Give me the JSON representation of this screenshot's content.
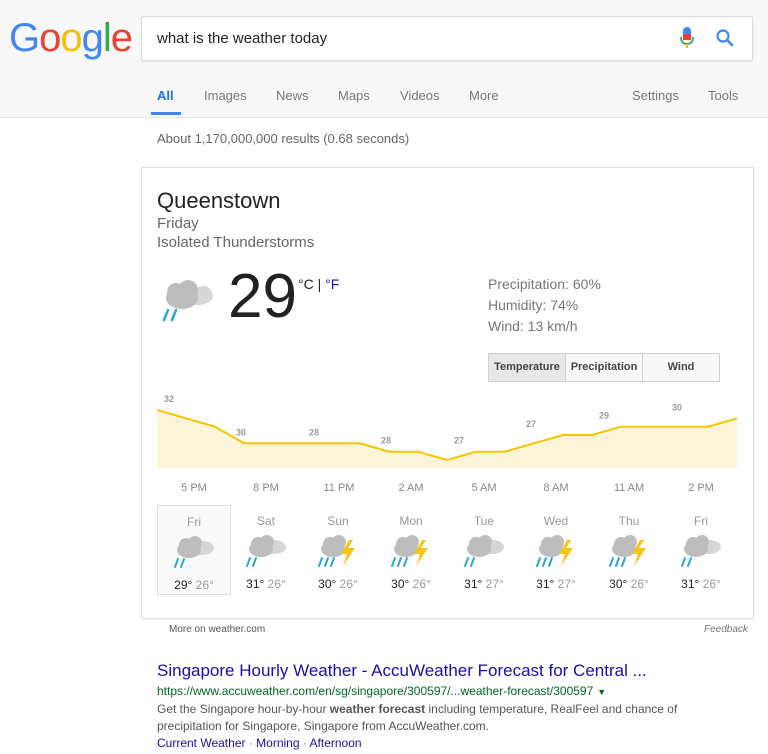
{
  "logo": {
    "letters": [
      "G",
      "o",
      "o",
      "g",
      "l",
      "e"
    ],
    "colors": [
      "#4285f4",
      "#ea4335",
      "#fbbc05",
      "#4285f4",
      "#34a853",
      "#ea4335"
    ]
  },
  "search": {
    "query": "what is the weather today",
    "mic_icon": "mic-icon",
    "search_icon": "search-icon"
  },
  "tabs": {
    "all": "All",
    "images": "Images",
    "news": "News",
    "maps": "Maps",
    "videos": "Videos",
    "more": "More",
    "settings": "Settings",
    "tools": "Tools"
  },
  "stats": "About 1,170,000,000 results (0.68 seconds)",
  "weather": {
    "location": "Queenstown",
    "day": "Friday",
    "condition": "Isolated Thunderstorms",
    "temp": "29",
    "unit_c": "°C",
    "unit_sep": " | ",
    "unit_f": "°F",
    "precipitation": "Precipitation: 60%",
    "humidity": "Humidity: 74%",
    "wind": "Wind: 13 km/h",
    "buttons": {
      "temperature": "Temperature",
      "precipitation": "Precipitation",
      "wind": "Wind"
    },
    "chart_data": {
      "type": "area",
      "temps": [
        32,
        31,
        30,
        28,
        28,
        28,
        28,
        28,
        27,
        27,
        26,
        27,
        27,
        28,
        29,
        29,
        30,
        30,
        30,
        30,
        31
      ],
      "labels": [
        "32",
        "30",
        "28",
        "28",
        "27",
        "27",
        "29",
        "30"
      ],
      "times": [
        "5 PM",
        "8 PM",
        "11 PM",
        "2 AM",
        "5 AM",
        "8 AM",
        "11 AM",
        "2 PM"
      ],
      "fill": "#fdf5d8",
      "stroke": "#f7c500"
    },
    "forecast": [
      {
        "day": "Fri",
        "hi": "29°",
        "lo": "26°",
        "icon": "rain-cloud-icon"
      },
      {
        "day": "Sat",
        "hi": "31°",
        "lo": "26°",
        "icon": "rain-cloud-icon"
      },
      {
        "day": "Sun",
        "hi": "30°",
        "lo": "26°",
        "icon": "thunderstorm-icon"
      },
      {
        "day": "Mon",
        "hi": "30°",
        "lo": "26°",
        "icon": "thunderstorm-icon"
      },
      {
        "day": "Tue",
        "hi": "31°",
        "lo": "27°",
        "icon": "rain-cloud-icon"
      },
      {
        "day": "Wed",
        "hi": "31°",
        "lo": "27°",
        "icon": "thunderstorm-icon"
      },
      {
        "day": "Thu",
        "hi": "30°",
        "lo": "26°",
        "icon": "thunderstorm-icon"
      },
      {
        "day": "Fri",
        "hi": "31°",
        "lo": "26°",
        "icon": "rain-cloud-icon"
      }
    ]
  },
  "footer": {
    "more": "More on weather.com",
    "feedback": "Feedback"
  },
  "result": {
    "title": "Singapore Hourly Weather - AccuWeather Forecast for Central ...",
    "url": "https://www.accuweather.com/en/sg/singapore/300597/...weather-forecast/300597",
    "snippet_pre": "Get the Singapore hour-by-hour ",
    "snippet_bold": "weather forecast",
    "snippet_post": " including temperature, RealFeel and chance of precipitation for Singapore, Singapore from AccuWeather.com.",
    "sitelinks": [
      "Current Weather",
      "Morning",
      "Afternoon"
    ],
    "sitelink_sep": " · "
  }
}
